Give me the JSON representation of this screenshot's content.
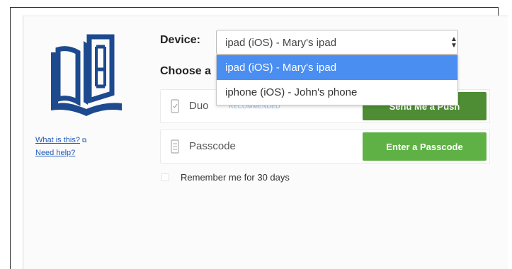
{
  "colors": {
    "brand_blue": "#1d4a8f",
    "push_button": "#4e8d33",
    "passcode_button": "#5fb146",
    "option_highlight": "#4a8ef2",
    "link": "#1f5bb8"
  },
  "icons": {
    "logo": "book-logo-icon",
    "external_link": "external-link-icon",
    "push": "phone-icon",
    "passcode": "keypad-icon",
    "select_arrow": "chevron-updown-icon"
  },
  "sidebar": {
    "what_is_this": "What is this?",
    "need_help": "Need help?"
  },
  "device": {
    "label": "Device:",
    "selected": "ipad (iOS) - Mary's ipad",
    "options": [
      "ipad (iOS) - Mary's ipad",
      "iphone (iOS) - John's phone"
    ]
  },
  "choose": {
    "label": "Choose a"
  },
  "methods": [
    {
      "name": "Duo",
      "tag": "RECOMMENDED",
      "button": "Send Me a Push"
    },
    {
      "name": "Passcode",
      "button": "Enter a Passcode"
    }
  ],
  "remember": {
    "label": "Remember me for 30 days"
  }
}
